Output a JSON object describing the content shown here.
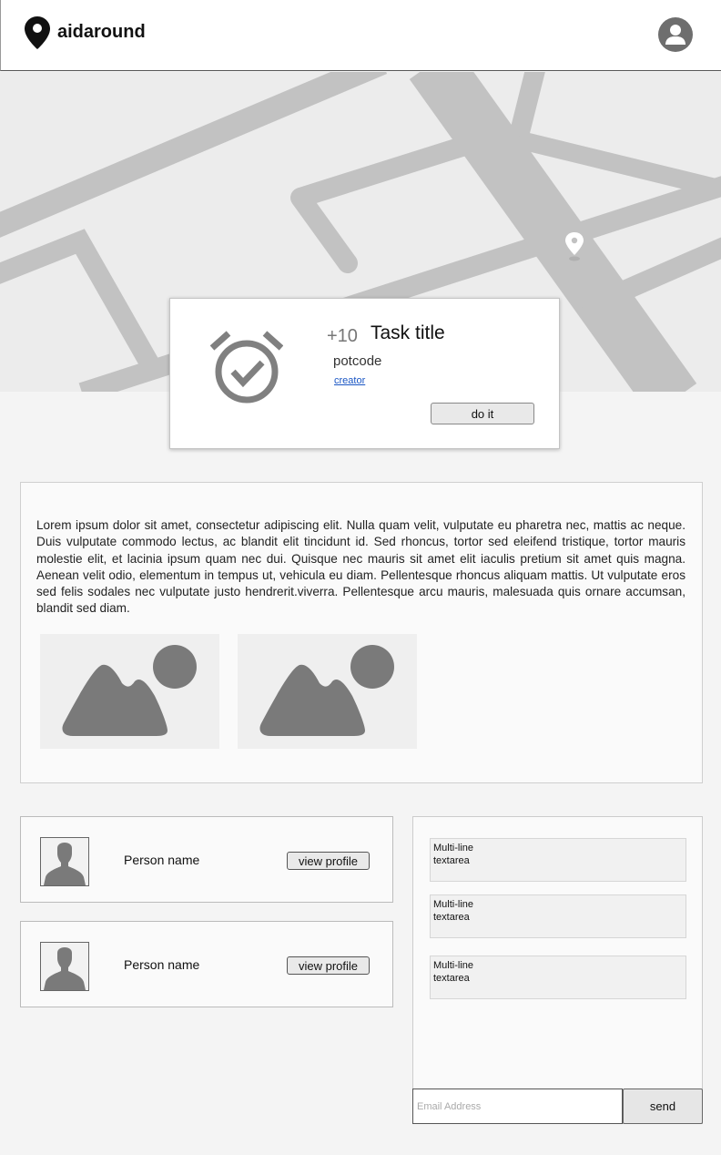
{
  "header": {
    "brand": "aidaround",
    "logo_icon": "map-pin-icon",
    "account_icon": "account-circle-icon"
  },
  "map": {
    "marker_icon": "map-marker-icon"
  },
  "task": {
    "points": "+10",
    "title": "Task title",
    "potcode": "potcode",
    "creator_link": "creator",
    "action_label": "do it",
    "icon": "alarm-check-icon"
  },
  "description": {
    "text": "Lorem ipsum dolor sit amet, consectetur adipiscing elit. Nulla quam velit, vulputate eu pharetra nec, mattis ac neque. Duis vulputate commodo lectus, ac blandit elit tincidunt id. Sed rhoncus, tortor sed eleifend tristique, tortor mauris molestie elit, et lacinia ipsum quam nec dui. Quisque nec mauris sit amet elit iaculis pretium sit amet quis magna. Aenean velit odio, elementum in tempus ut, vehicula eu diam. Pellentesque rhoncus aliquam mattis. Ut vulputate eros sed felis sodales nec vulputate justo hendrerit.viverra. Pellentesque arcu mauris, malesuada quis ornare accumsan, blandit sed diam.",
    "image_icon": "image-placeholder-icon"
  },
  "people": [
    {
      "name": "Person name",
      "button": "view profile"
    },
    {
      "name": "Person name",
      "button": "view profile"
    }
  ],
  "chat": {
    "messages": [
      {
        "line1": "Multi-line",
        "line2": "textarea"
      },
      {
        "line1": "Multi-line",
        "line2": "textarea"
      },
      {
        "line1": "Multi-line",
        "line2": "textarea"
      }
    ],
    "email_placeholder": "Email Address",
    "send_label": "send"
  },
  "colors": {
    "map_background": "#ececec",
    "map_roads": "#c2c2c2",
    "icon_gray": "#808080",
    "link_blue": "#1a56c4"
  }
}
